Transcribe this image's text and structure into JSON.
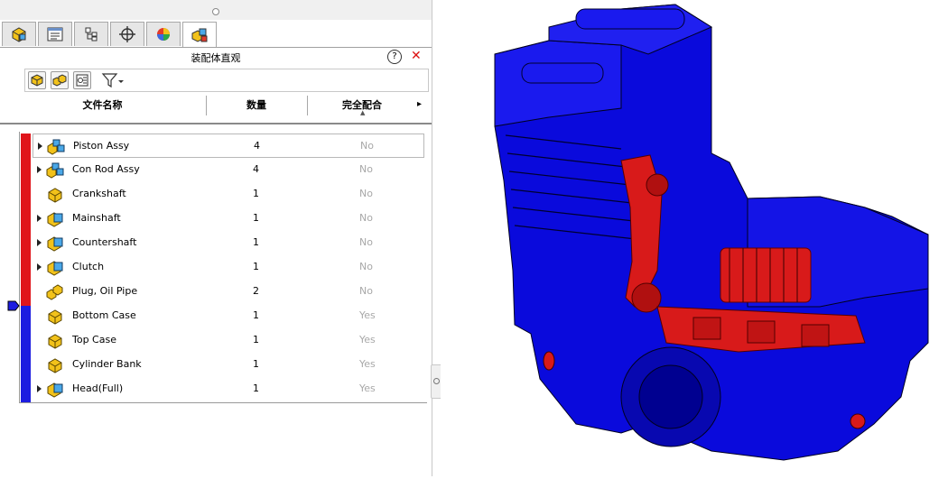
{
  "panel": {
    "title": "装配体直观",
    "help_label": "?",
    "close_label": "✕"
  },
  "tabs": [
    {
      "icon": "assembly-icon"
    },
    {
      "icon": "property-manager-icon"
    },
    {
      "icon": "configuration-manager-icon"
    },
    {
      "icon": "dimxpert-icon"
    },
    {
      "icon": "display-manager-icon"
    },
    {
      "icon": "assembly-visualization-icon",
      "active": true
    }
  ],
  "columns": {
    "name": "文件名称",
    "qty": "数量",
    "mate": "完全配合",
    "more": "▸"
  },
  "rows": [
    {
      "name": "Piston Assy",
      "qty": "4",
      "mate": "No",
      "expandable": true,
      "icon": "subassembly-icon",
      "selected": true
    },
    {
      "name": "Con Rod Assy",
      "qty": "4",
      "mate": "No",
      "expandable": true,
      "icon": "subassembly-icon"
    },
    {
      "name": "Crankshaft",
      "qty": "1",
      "mate": "No",
      "expandable": false,
      "icon": "part-icon"
    },
    {
      "name": "Mainshaft",
      "qty": "1",
      "mate": "No",
      "expandable": true,
      "icon": "assembly-icon"
    },
    {
      "name": "Countershaft",
      "qty": "1",
      "mate": "No",
      "expandable": true,
      "icon": "assembly-icon"
    },
    {
      "name": "Clutch",
      "qty": "1",
      "mate": "No",
      "expandable": true,
      "icon": "assembly-icon"
    },
    {
      "name": "Plug, Oil Pipe",
      "qty": "2",
      "mate": "No",
      "expandable": false,
      "icon": "multi-part-icon"
    },
    {
      "name": "Bottom Case",
      "qty": "1",
      "mate": "Yes",
      "expandable": false,
      "icon": "part-icon"
    },
    {
      "name": "Top Case",
      "qty": "1",
      "mate": "Yes",
      "expandable": false,
      "icon": "part-icon"
    },
    {
      "name": "Cylinder Bank",
      "qty": "1",
      "mate": "Yes",
      "expandable": false,
      "icon": "part-icon"
    },
    {
      "name": "Head(Full)",
      "qty": "1",
      "mate": "Yes",
      "expandable": true,
      "icon": "assembly-icon"
    }
  ],
  "colors": {
    "bar_red": "#e0151b",
    "bar_blue": "#1c1ce0",
    "model_blue": "#0a0adc",
    "model_red": "#d81a1a",
    "part_yellow": "#f2c21a",
    "subassy_blue": "#4aa8e8"
  },
  "slider": {
    "split_fraction": 0.64
  }
}
